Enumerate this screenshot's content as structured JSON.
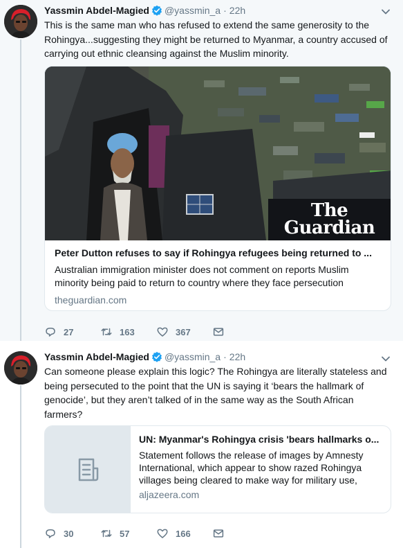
{
  "tweets": [
    {
      "author": {
        "name": "Yassmin Abdel-Magied",
        "handle": "@yassmin_a",
        "verified": true
      },
      "time": "22h",
      "text": "This is the same man who has refused to extend the same generosity to the Rohingya...suggesting they might be returned to Myanmar, a country accused of carrying out ethnic cleansing against the Muslim minority.",
      "card": {
        "watermark": "The Guardian",
        "title": "Peter Dutton refuses to say if Rohingya refugees being returned to ...",
        "description": "Australian immigration minister does not comment on reports Muslim minority being paid to return to country where they face persecution",
        "domain": "theguardian.com"
      },
      "actions": {
        "replies": "27",
        "retweets": "163",
        "likes": "367"
      }
    },
    {
      "author": {
        "name": "Yassmin Abdel-Magied",
        "handle": "@yassmin_a",
        "verified": true
      },
      "time": "22h",
      "text": "Can someone please explain this logic? The Rohingya are literally stateless and being persecuted to the point that the UN is saying it ‘bears the hallmark of genocide’, but they aren’t talked of in the same way as the South African farmers?",
      "card": {
        "title": "UN: Myanmar's Rohingya crisis 'bears hallmarks o...",
        "description": "Statement follows the release of images by Amnesty International, which appear to show razed Rohingya villages being cleared to make way for military use,",
        "domain": "aljazeera.com"
      },
      "actions": {
        "replies": "30",
        "retweets": "57",
        "likes": "166"
      }
    }
  ],
  "colors": {
    "verified": "#1da1f2",
    "secondary_text": "#657786",
    "thread_line": "#ccd6dd",
    "background_highlight": "#f5f8fa"
  },
  "icons": {
    "verified": "verified-badge-icon",
    "caret": "chevron-down-icon",
    "reply": "reply-icon",
    "retweet": "retweet-icon",
    "like": "heart-icon",
    "dm": "envelope-icon",
    "card_placeholder": "document-icon"
  }
}
